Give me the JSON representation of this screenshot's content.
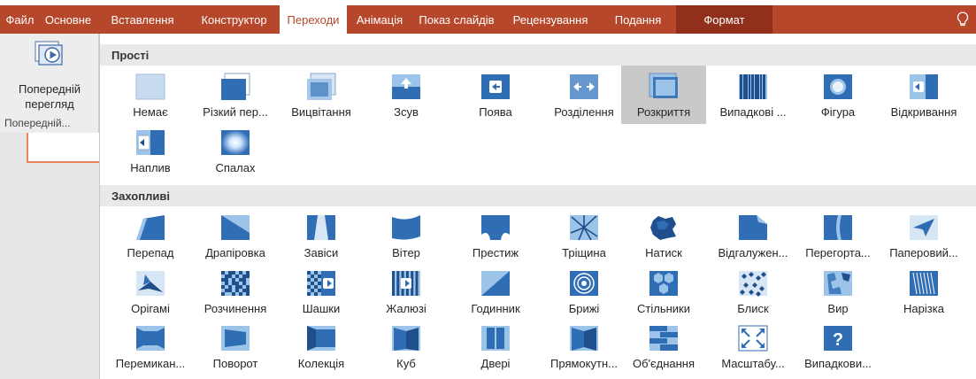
{
  "ribbon": {
    "tabs": [
      {
        "label": "Файл"
      },
      {
        "label": "Основне"
      },
      {
        "label": "Вставлення"
      },
      {
        "label": "Конструктор"
      },
      {
        "label": "Переходи",
        "active": true
      },
      {
        "label": "Анімація"
      },
      {
        "label": "Показ слайдів"
      },
      {
        "label": "Рецензування"
      },
      {
        "label": "Подання"
      },
      {
        "label": "Формат",
        "format": true
      }
    ],
    "help_icon": "lightbulb-icon",
    "colors": {
      "ribbon": "#b7472a",
      "format_tab": "#8f2f1c",
      "selected_tile": "#c9c9c9"
    }
  },
  "preview": {
    "label_line1": "Попередній",
    "label_line2": "перегляд",
    "group_label": "Попередній..."
  },
  "gallery": {
    "sections": [
      {
        "title": "Прості",
        "items": [
          {
            "label": "Немає",
            "icon": "none-transition-icon"
          },
          {
            "label": "Різкий пер...",
            "icon": "cut-transition-icon"
          },
          {
            "label": "Вицвітання",
            "icon": "fade-transition-icon"
          },
          {
            "label": "Зсув",
            "icon": "push-transition-icon"
          },
          {
            "label": "Поява",
            "icon": "wipe-transition-icon"
          },
          {
            "label": "Розділення",
            "icon": "split-transition-icon"
          },
          {
            "label": "Розкриття",
            "icon": "reveal-transition-icon",
            "selected": true
          },
          {
            "label": "Випадкові ...",
            "icon": "random-bars-transition-icon"
          },
          {
            "label": "Фігура",
            "icon": "shape-transition-icon"
          },
          {
            "label": "Відкривання",
            "icon": "uncover-transition-icon"
          },
          {
            "label": "Наплив",
            "icon": "cover-transition-icon"
          },
          {
            "label": "Спалах",
            "icon": "flash-transition-icon"
          }
        ]
      },
      {
        "title": "Захопливі",
        "items": [
          {
            "label": "Перепад",
            "icon": "fall-over-transition-icon"
          },
          {
            "label": "Драпіровка",
            "icon": "drape-transition-icon"
          },
          {
            "label": "Завіси",
            "icon": "curtains-transition-icon"
          },
          {
            "label": "Вітер",
            "icon": "wind-transition-icon"
          },
          {
            "label": "Престиж",
            "icon": "prestige-transition-icon"
          },
          {
            "label": "Тріщина",
            "icon": "fracture-transition-icon"
          },
          {
            "label": "Натиск",
            "icon": "crush-transition-icon"
          },
          {
            "label": "Відгалужен...",
            "icon": "peel-off-transition-icon"
          },
          {
            "label": "Перегорта...",
            "icon": "page-curl-transition-icon"
          },
          {
            "label": "Паперовий...",
            "icon": "airplane-transition-icon"
          },
          {
            "label": "Орігамі",
            "icon": "origami-transition-icon"
          },
          {
            "label": "Розчинення",
            "icon": "dissolve-transition-icon"
          },
          {
            "label": "Шашки",
            "icon": "checkerboard-transition-icon"
          },
          {
            "label": "Жалюзі",
            "icon": "blinds-transition-icon"
          },
          {
            "label": "Годинник",
            "icon": "clock-transition-icon"
          },
          {
            "label": "Брижі",
            "icon": "ripple-transition-icon"
          },
          {
            "label": "Стільники",
            "icon": "honeycomb-transition-icon"
          },
          {
            "label": "Блиск",
            "icon": "glitter-transition-icon"
          },
          {
            "label": "Вир",
            "icon": "vortex-transition-icon"
          },
          {
            "label": "Нарізка",
            "icon": "shred-transition-icon"
          },
          {
            "label": "Перемикан...",
            "icon": "switch-transition-icon"
          },
          {
            "label": "Поворот",
            "icon": "flip-transition-icon"
          },
          {
            "label": "Колекція",
            "icon": "gallery-transition-icon"
          },
          {
            "label": "Куб",
            "icon": "cube-transition-icon"
          },
          {
            "label": "Двері",
            "icon": "doors-transition-icon"
          },
          {
            "label": "Прямокутн...",
            "icon": "box-transition-icon"
          },
          {
            "label": "Об'єднання",
            "icon": "comb-transition-icon"
          },
          {
            "label": "Масштабу...",
            "icon": "zoom-transition-icon"
          },
          {
            "label": "Випадкови...",
            "icon": "random-transition-icon"
          }
        ]
      }
    ]
  }
}
